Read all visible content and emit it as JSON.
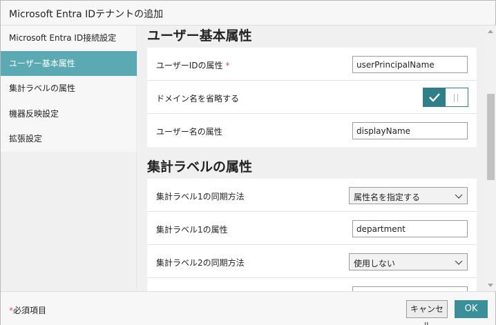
{
  "window": {
    "title": "Microsoft Entra IDテナントの追加"
  },
  "sidebar": {
    "items": [
      {
        "label": "Microsoft Entra ID接続設定",
        "active": false
      },
      {
        "label": "ユーザー基本属性",
        "active": true
      },
      {
        "label": "集計ラベルの属性",
        "active": false
      },
      {
        "label": "機器反映設定",
        "active": false
      },
      {
        "label": "拡張設定",
        "active": false
      }
    ]
  },
  "user_basic": {
    "section_title": "ユーザー基本属性",
    "user_id_label": "ユーザーIDの属性",
    "required_mark": "*",
    "user_id_value": "userPrincipalName",
    "omit_domain_label": "ドメイン名を省略する",
    "omit_domain_enabled": true,
    "user_name_label": "ユーザー名の属性",
    "user_name_value": "displayName"
  },
  "agg_labels": {
    "section_title": "集計ラベルの属性",
    "label1_sync_label": "集計ラベル1の同期方法",
    "label1_sync_value": "属性名を指定する",
    "label1_attr_label": "集計ラベル1の属性",
    "label1_attr_value": "department",
    "label2_sync_label": "集計ラベル2の同期方法",
    "label2_sync_value": "使用しない"
  },
  "footer": {
    "required_star": "*",
    "required_note": "必須項目",
    "cancel_label": "キャンセル",
    "ok_label": "OK"
  },
  "colors": {
    "accent": "#5ba9b3",
    "toggle_on": "#2f7f88",
    "ok_button": "#3b8f99",
    "required": "#d9534f"
  }
}
